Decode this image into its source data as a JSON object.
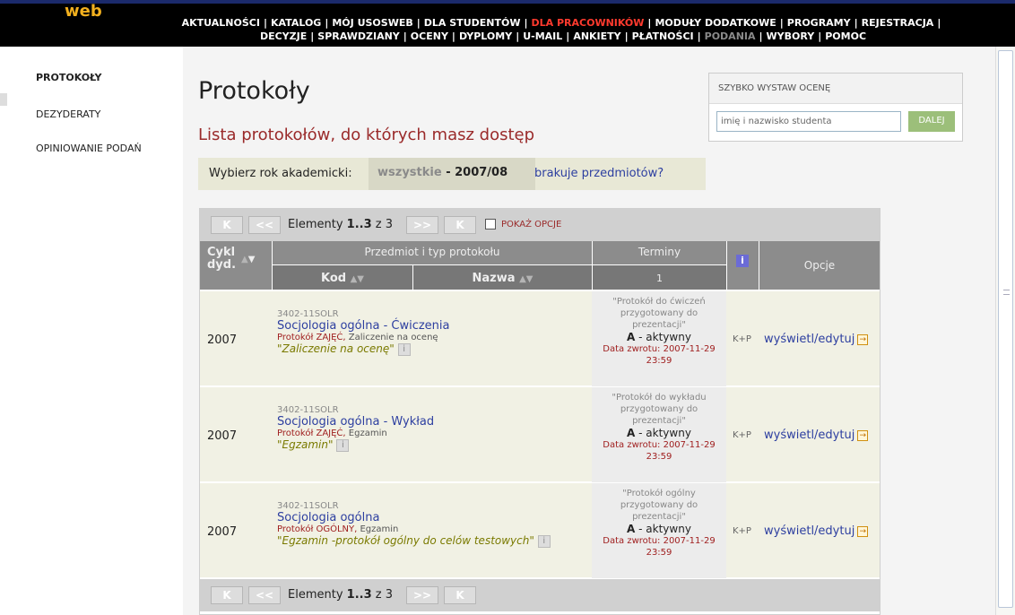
{
  "app": {
    "logo_text": "web"
  },
  "nav": {
    "row1": [
      "AKTUALNOŚCI",
      "KATALOG",
      "MÓJ USOSWEB",
      "DLA STUDENTÓW",
      "DLA PRACOWNIKÓW",
      "MODUŁY DODATKOWE",
      "PROGRAMY",
      "REJESTRACJA"
    ],
    "row2": [
      "DECYZJE",
      "SPRAWDZIANY",
      "OCENY",
      "DYPLOMY",
      "U-MAIL",
      "ANKIETY",
      "PŁATNOŚCI",
      "PODANIA",
      "WYBORY",
      "POMOC"
    ],
    "active": "DLA PRACOWNIKÓW",
    "dim": "PODANIA"
  },
  "sidebar": {
    "items": [
      "PROTOKOŁY",
      "DEZYDERATY",
      "OPINIOWANIE PODAŃ"
    ]
  },
  "page": {
    "title": "Protokoły",
    "subtitle": "Lista protokołów, do których masz dostęp",
    "year_label": "Wybierz rok akademicki:",
    "year_all": "wszystkie",
    "year_sep": " - ",
    "year_value": "2007/08",
    "missing_link": "brakuje przedmiotów?"
  },
  "quick": {
    "title": "SZYBKO WYSTAW OCENĘ",
    "placeholder": "imię i nazwisko studenta",
    "button": "DALEJ"
  },
  "pager": {
    "first": "K",
    "prev": "<<",
    "next": ">>",
    "last": "K",
    "label": "Elementy",
    "range": "1..3",
    "of": "z 3",
    "show_options": "POKAŻ OPCJE"
  },
  "table": {
    "headers": {
      "cycle": "Cykl dyd.",
      "subject_group": "Przedmiot i typ protokołu",
      "code": "Kod",
      "name": "Nazwa",
      "terms": "Terminy",
      "terms_sub": "1",
      "info": "i",
      "options": "Opcje"
    },
    "rows": [
      {
        "cycle": "2007",
        "code": "3402-11SOLR",
        "subject": "Socjologia ogólna",
        "subject_type": " - Ćwiczenia",
        "protocol_type": "Protokół ZAJĘĆ,",
        "protocol_kind": " Zaliczenie na ocenę",
        "desc": "\"Zaliczenie na ocenę\"",
        "term_desc": "\"Protokół do ćwiczeń przygotowany do prezentacji\"",
        "status_code": "A",
        "status_text": " - aktywny",
        "return_date": "Data zwrotu: 2007-11-29 23:59",
        "info_code": "K+P",
        "action": "wyświetl/edytuj"
      },
      {
        "cycle": "2007",
        "code": "3402-11SOLR",
        "subject": "Socjologia ogólna",
        "subject_type": " - Wykład",
        "protocol_type": "Protokół ZAJĘĆ,",
        "protocol_kind": " Egzamin",
        "desc": "\"Egzamin\"",
        "term_desc": "\"Protokół do wykładu przygotowany do prezentacji\"",
        "status_code": "A",
        "status_text": " - aktywny",
        "return_date": "Data zwrotu: 2007-11-29 23:59",
        "info_code": "K+P",
        "action": "wyświetl/edytuj"
      },
      {
        "cycle": "2007",
        "code": "3402-11SOLR",
        "subject": "Socjologia ogólna",
        "subject_type": "",
        "protocol_type": "Protokół OGÓLNY,",
        "protocol_kind": " Egzamin",
        "desc": "\"Egzamin -protokół ogólny do celów testowych\"",
        "term_desc": "\"Protokół ogólny przygotowany do prezentacji\"",
        "status_code": "A",
        "status_text": " - aktywny",
        "return_date": "Data zwrotu: 2007-11-29 23:59",
        "info_code": "K+P",
        "action": "wyświetl/edytuj"
      }
    ]
  }
}
